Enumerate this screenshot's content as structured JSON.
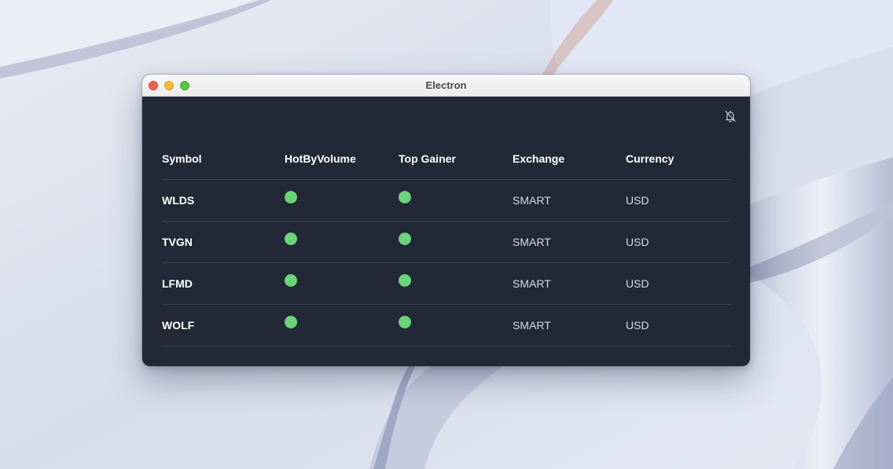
{
  "window": {
    "title": "Electron"
  },
  "toolbar": {
    "notification_icon": "bell-off-icon"
  },
  "colors": {
    "background": "#222835",
    "accent_dot": "#6bd37a",
    "header_text": "#ffffff"
  },
  "table": {
    "columns": [
      "Symbol",
      "HotByVolume",
      "Top Gainer",
      "Exchange",
      "Currency"
    ],
    "rows": [
      {
        "symbol": "WLDS",
        "hot_by_volume": true,
        "top_gainer": true,
        "exchange": "SMART",
        "currency": "USD"
      },
      {
        "symbol": "TVGN",
        "hot_by_volume": true,
        "top_gainer": true,
        "exchange": "SMART",
        "currency": "USD"
      },
      {
        "symbol": "LFMD",
        "hot_by_volume": true,
        "top_gainer": true,
        "exchange": "SMART",
        "currency": "USD"
      },
      {
        "symbol": "WOLF",
        "hot_by_volume": true,
        "top_gainer": true,
        "exchange": "SMART",
        "currency": "USD"
      }
    ]
  }
}
